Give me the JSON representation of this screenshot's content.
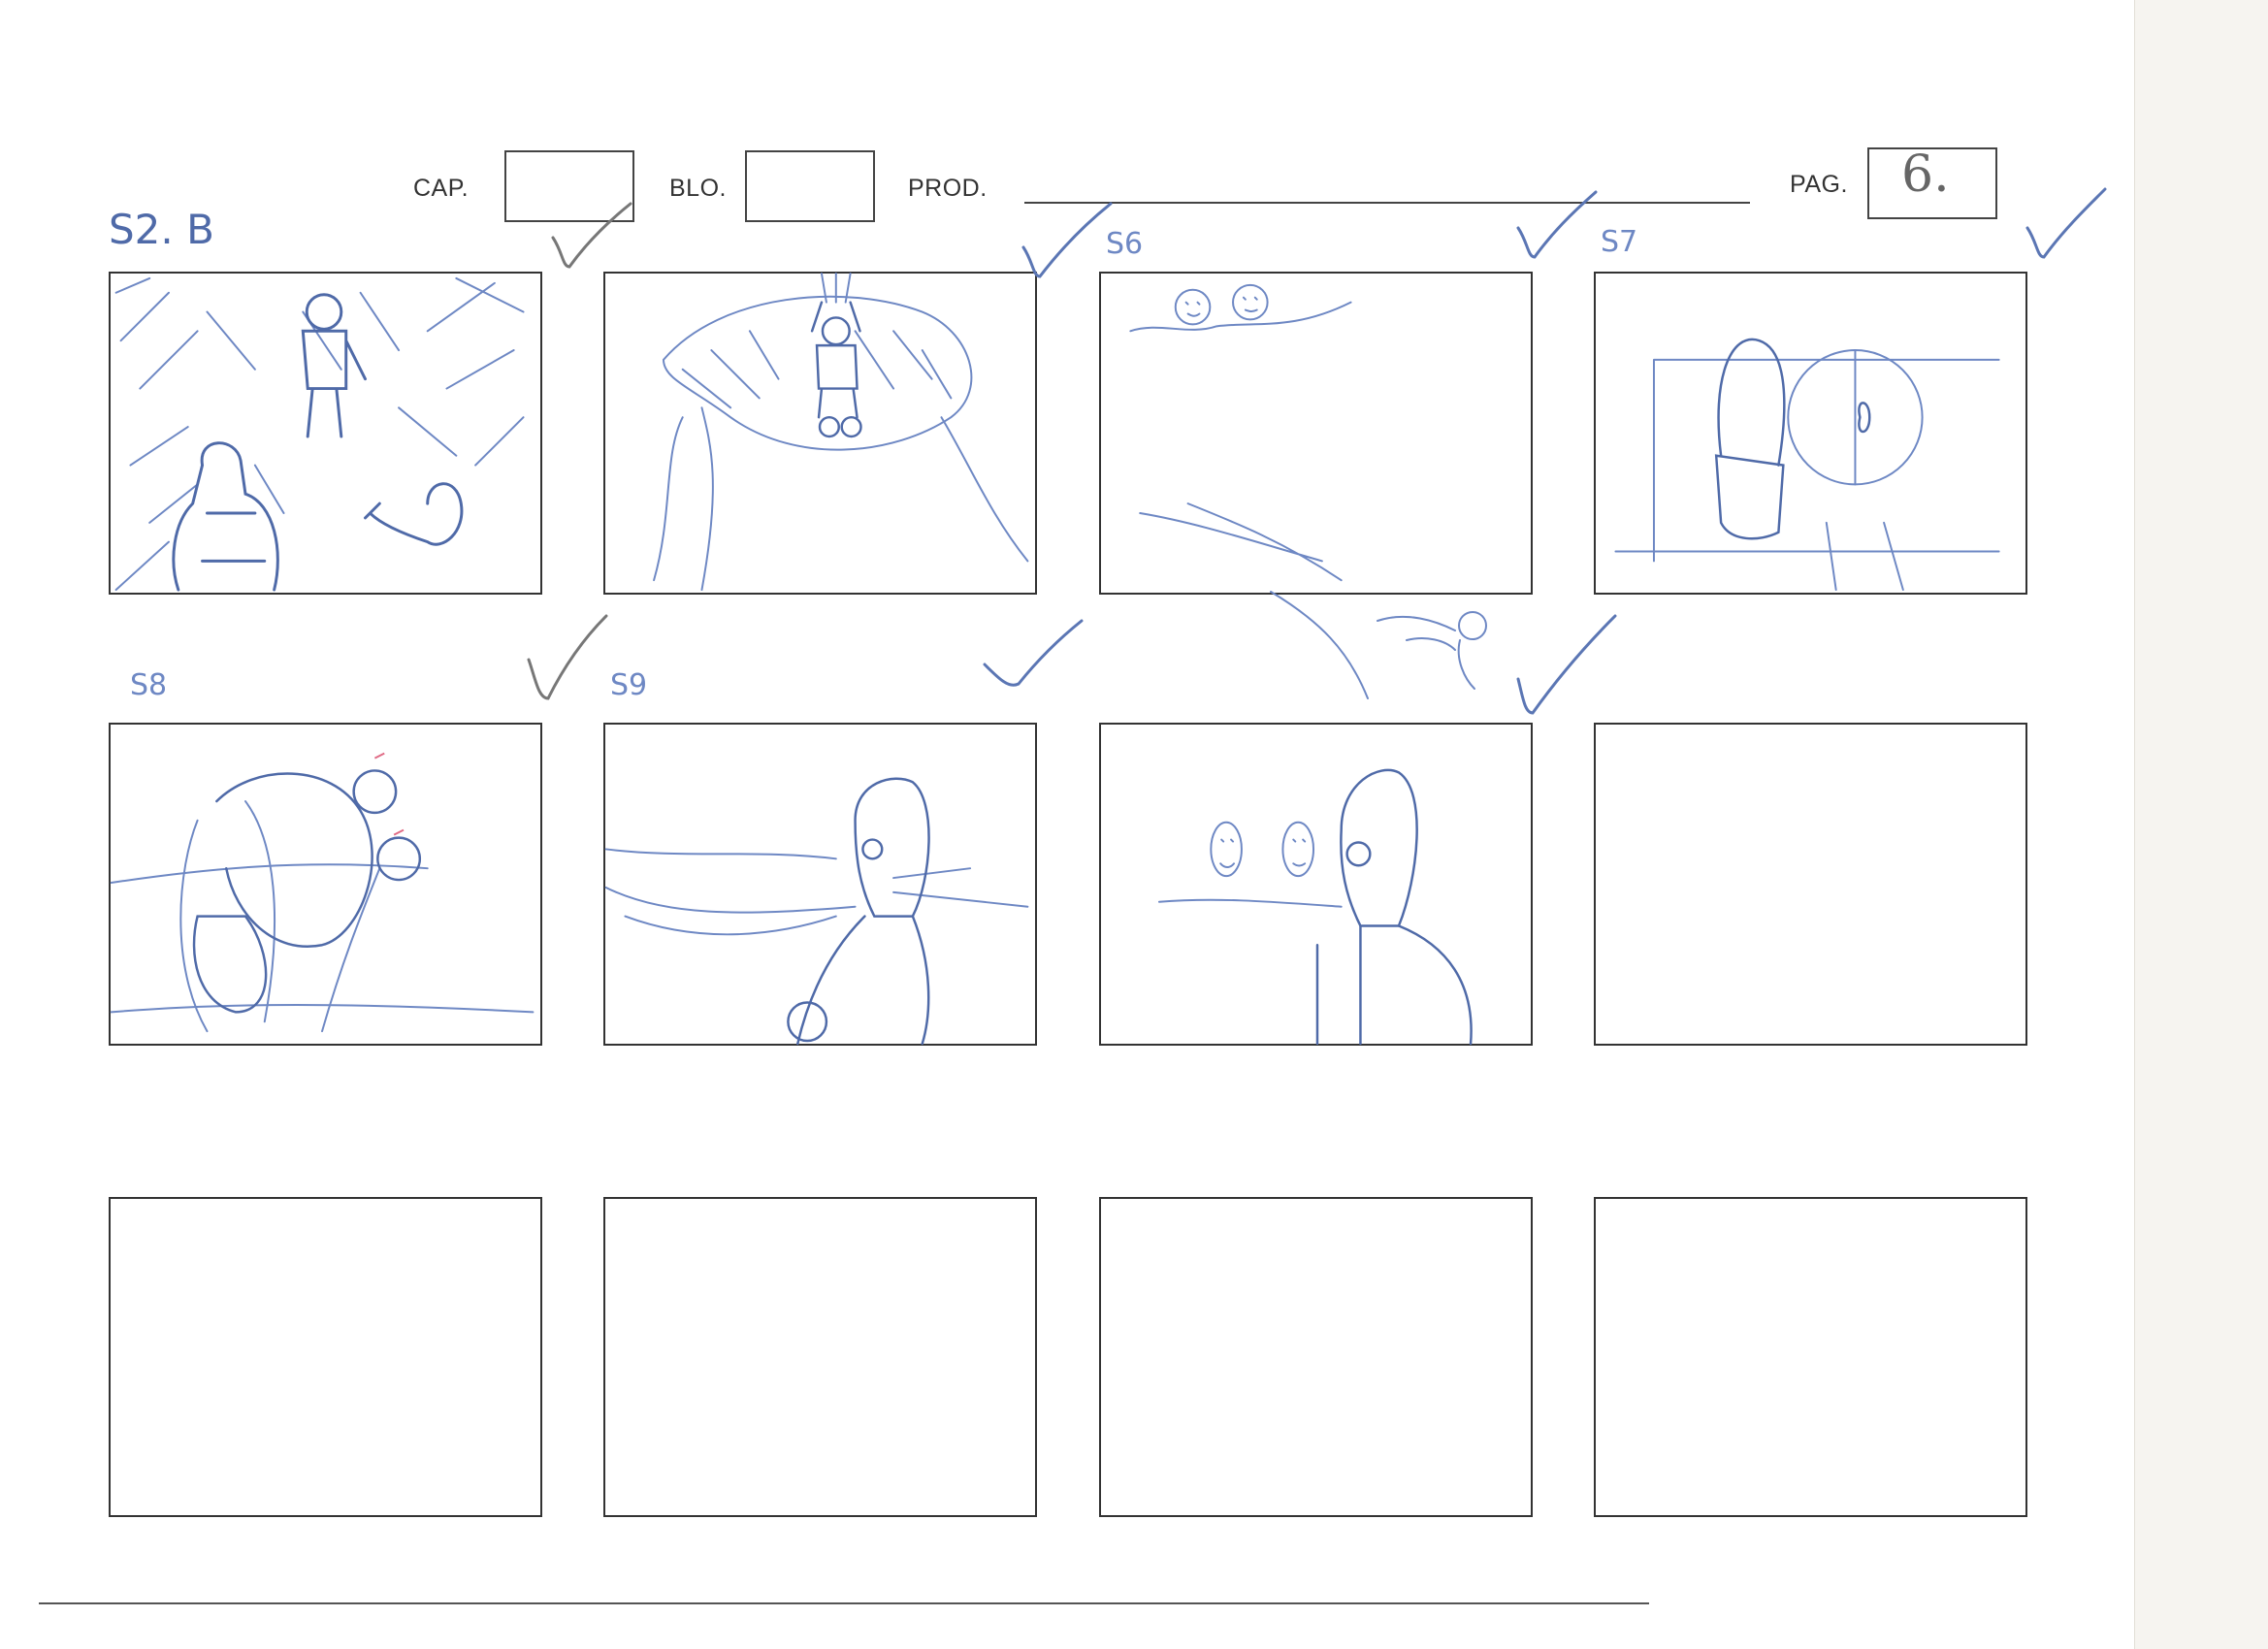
{
  "header": {
    "cap_label": "CAP.",
    "blo_label": "BLO.",
    "prod_label": "PROD.",
    "pag_label": "PAG.",
    "cap_value": "",
    "blo_value": "",
    "prod_value": "",
    "pag_value": "6."
  },
  "top_note": "S2. B",
  "panel_labels": {
    "p2": "",
    "p3": "S6",
    "p4": "S7",
    "p5": "S8",
    "p6": "S9",
    "p7": "",
    "p8": ""
  },
  "colors": {
    "pencil_blue": "#5b76b4",
    "frame_border": "#333333",
    "paper": "#ffffff"
  }
}
